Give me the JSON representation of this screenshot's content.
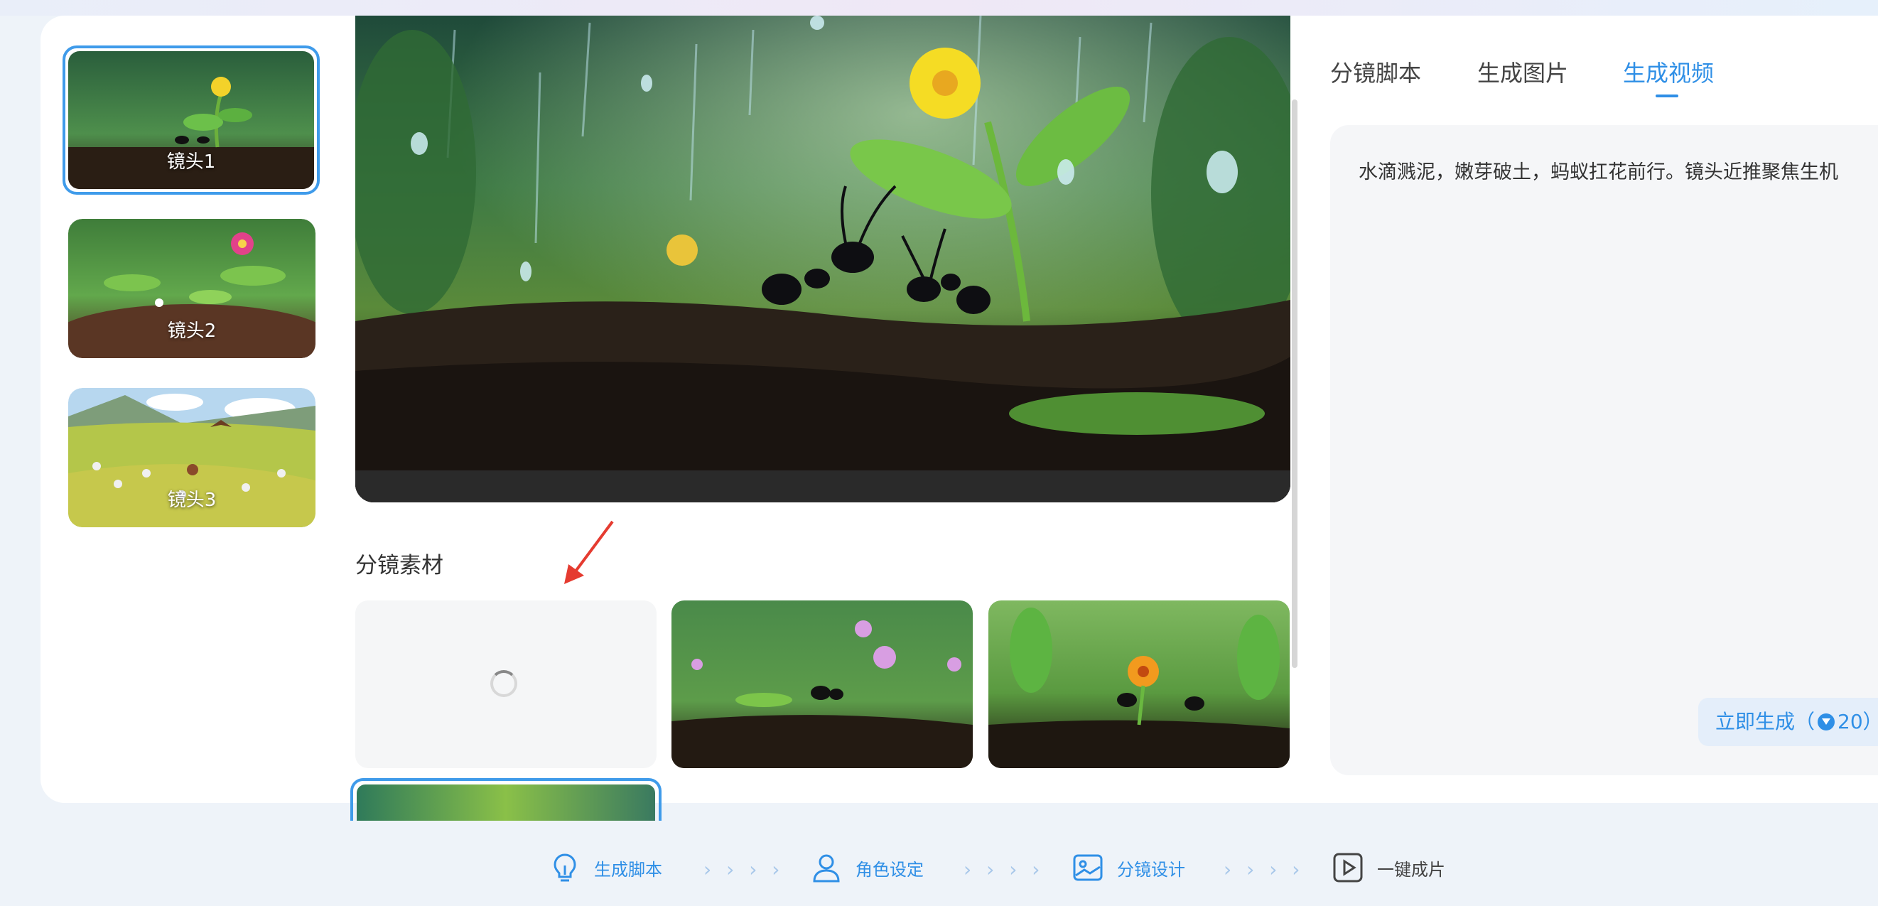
{
  "shots": [
    {
      "label": "镜头1",
      "selected": true
    },
    {
      "label": "镜头2",
      "selected": false
    },
    {
      "label": "镜头3",
      "selected": false
    }
  ],
  "materials": {
    "title": "分镜素材"
  },
  "right_panel": {
    "tabs": [
      "分镜脚本",
      "生成图片",
      "生成视频"
    ],
    "active_tab": "生成视频",
    "prompt": "水滴溅泥，嫩芽破土，蚂蚁扛花前行。镜头近推聚焦生机",
    "generate_label": "立即生成（",
    "generate_cost": "20）"
  },
  "steps": [
    {
      "label": "生成脚本",
      "icon": "lightbulb-icon"
    },
    {
      "label": "角色设定",
      "icon": "user-icon"
    },
    {
      "label": "分镜设计",
      "icon": "storyboard-icon"
    },
    {
      "label": "一键成片",
      "icon": "play-icon"
    }
  ],
  "step_separator": "› › › ›",
  "colors": {
    "accent": "#2f8fe6",
    "selected_border": "#3f9bea",
    "panel_bg": "#f5f6f8"
  }
}
